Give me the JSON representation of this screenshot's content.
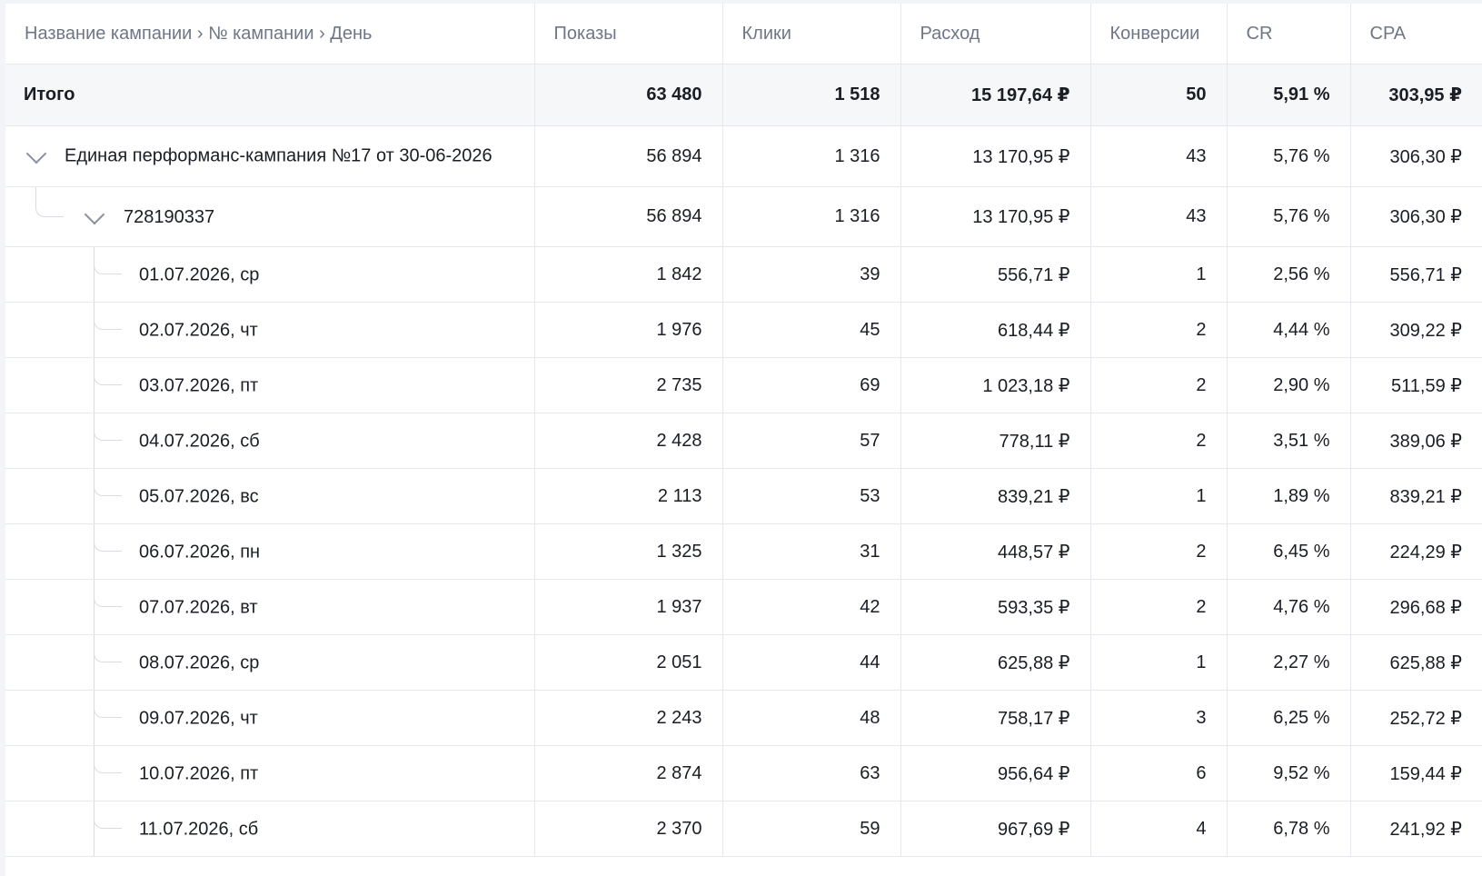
{
  "columns": {
    "name": "Название кампании › № кампании › День",
    "shows": "Показы",
    "clicks": "Клики",
    "cost": "Расход",
    "conversions": "Конверсии",
    "cr": "CR",
    "cpa": "CPA"
  },
  "total": {
    "label": "Итого",
    "shows": "63 480",
    "clicks": "1 518",
    "cost": "15 197,64 ₽",
    "conversions": "50",
    "cr": "5,91 %",
    "cpa": "303,95 ₽"
  },
  "campaign": {
    "label": "Единая перформанс-кампания №17 от 30-06-2026",
    "shows": "56 894",
    "clicks": "1 316",
    "cost": "13 170,95 ₽",
    "conversions": "43",
    "cr": "5,76 %",
    "cpa": "306,30 ₽",
    "expanded_icon": "chevron-down-icon"
  },
  "campaign_id": {
    "label": "728190337",
    "shows": "56 894",
    "clicks": "1 316",
    "cost": "13 170,95 ₽",
    "conversions": "43",
    "cr": "5,76 %",
    "cpa": "306,30 ₽",
    "expanded_icon": "chevron-down-icon"
  },
  "days": [
    {
      "label": "01.07.2026, ср",
      "shows": "1 842",
      "clicks": "39",
      "cost": "556,71 ₽",
      "conversions": "1",
      "cr": "2,56 %",
      "cpa": "556,71 ₽"
    },
    {
      "label": "02.07.2026, чт",
      "shows": "1 976",
      "clicks": "45",
      "cost": "618,44 ₽",
      "conversions": "2",
      "cr": "4,44 %",
      "cpa": "309,22 ₽"
    },
    {
      "label": "03.07.2026, пт",
      "shows": "2 735",
      "clicks": "69",
      "cost": "1 023,18 ₽",
      "conversions": "2",
      "cr": "2,90 %",
      "cpa": "511,59 ₽"
    },
    {
      "label": "04.07.2026, сб",
      "shows": "2 428",
      "clicks": "57",
      "cost": "778,11 ₽",
      "conversions": "2",
      "cr": "3,51 %",
      "cpa": "389,06 ₽"
    },
    {
      "label": "05.07.2026, вс",
      "shows": "2 113",
      "clicks": "53",
      "cost": "839,21 ₽",
      "conversions": "1",
      "cr": "1,89 %",
      "cpa": "839,21 ₽"
    },
    {
      "label": "06.07.2026, пн",
      "shows": "1 325",
      "clicks": "31",
      "cost": "448,57 ₽",
      "conversions": "2",
      "cr": "6,45 %",
      "cpa": "224,29 ₽"
    },
    {
      "label": "07.07.2026, вт",
      "shows": "1 937",
      "clicks": "42",
      "cost": "593,35 ₽",
      "conversions": "2",
      "cr": "4,76 %",
      "cpa": "296,68 ₽"
    },
    {
      "label": "08.07.2026, ср",
      "shows": "2 051",
      "clicks": "44",
      "cost": "625,88 ₽",
      "conversions": "1",
      "cr": "2,27 %",
      "cpa": "625,88 ₽"
    },
    {
      "label": "09.07.2026, чт",
      "shows": "2 243",
      "clicks": "48",
      "cost": "758,17 ₽",
      "conversions": "3",
      "cr": "6,25 %",
      "cpa": "252,72 ₽"
    },
    {
      "label": "10.07.2026, пт",
      "shows": "2 874",
      "clicks": "63",
      "cost": "956,64 ₽",
      "conversions": "6",
      "cr": "9,52 %",
      "cpa": "159,44 ₽"
    },
    {
      "label": "11.07.2026, сб",
      "shows": "2 370",
      "clicks": "59",
      "cost": "967,69 ₽",
      "conversions": "4",
      "cr": "6,78 %",
      "cpa": "241,92 ₽"
    }
  ]
}
